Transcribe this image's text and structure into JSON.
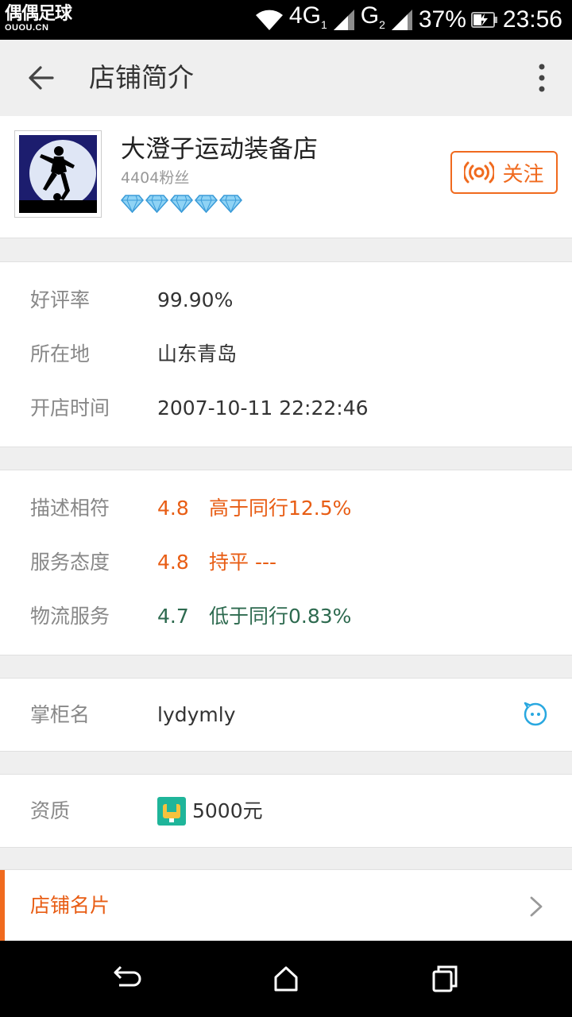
{
  "status_bar": {
    "logo_line1": "偶偶足球",
    "logo_line2": "OUOU.CN",
    "network1": "4G",
    "network1_sub": "1",
    "network2": "G",
    "network2_sub": "2",
    "battery": "37%",
    "time": "23:56",
    "icons": [
      "wifi-icon",
      "signal-icon",
      "signal-icon",
      "battery-charging-icon"
    ]
  },
  "appbar": {
    "title": "店铺简介",
    "back_icon": "back-arrow-icon",
    "more_icon": "more-vertical-icon"
  },
  "shop": {
    "name": "大澄子运动装备店",
    "fans": "4404粉丝",
    "diamonds": 5,
    "follow_label": "关注",
    "follow_icon": "broadcast-icon"
  },
  "basic_info": {
    "rating_label": "好评率",
    "rating_value": "99.90%",
    "location_label": "所在地",
    "location_value": "山东青岛",
    "opened_label": "开店时间",
    "opened_value": "2007-10-11 22:22:46"
  },
  "scores": [
    {
      "label": "描述相符",
      "score": "4.8",
      "compare": "高于同行12.5%",
      "color": "#e85d14"
    },
    {
      "label": "服务态度",
      "score": "4.8",
      "compare": "持平 ---",
      "color": "#e85d14"
    },
    {
      "label": "物流服务",
      "score": "4.7",
      "compare": "低于同行0.83%",
      "color": "#2d6a4f"
    }
  ],
  "owner": {
    "label": "掌柜名",
    "value": "lydymly",
    "icon": "chat-face-icon"
  },
  "qualification": {
    "label": "资质",
    "value": "5000元",
    "icon": "deposit-badge-icon"
  },
  "card_link": {
    "label": "店铺名片",
    "icon": "chevron-right-icon"
  },
  "navbar": {
    "icons": [
      "back-icon",
      "home-icon",
      "recents-icon"
    ]
  },
  "colors": {
    "accent": "#f06a1e",
    "orange_text": "#e85d14",
    "green_text": "#2d6a4f",
    "link_blue": "#29a8e0"
  }
}
